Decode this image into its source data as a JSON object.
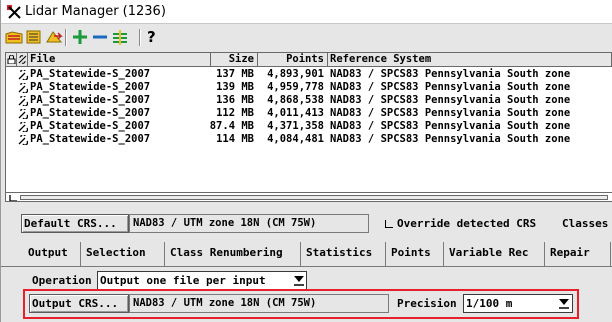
{
  "window": {
    "title": "Lidar Manager (1236)"
  },
  "toolbar": {
    "buttons": [
      "open-files-icon",
      "open-folder-icon",
      "import-icon",
      "add-icon",
      "remove-icon",
      "remove-all-icon",
      "help-icon"
    ],
    "help_label": "?"
  },
  "list": {
    "headers": {
      "file": "File",
      "size": "Size",
      "points": "Points",
      "crs": "Reference System"
    },
    "rows": [
      {
        "file": "PA_Statewide-S_2007",
        "size": "137 MB",
        "points": "4,893,901",
        "crs": "NAD83 / SPCS83 Pennsylvania South zone"
      },
      {
        "file": "PA_Statewide-S_2007",
        "size": "139 MB",
        "points": "4,959,778",
        "crs": "NAD83 / SPCS83 Pennsylvania South zone"
      },
      {
        "file": "PA_Statewide-S_2007",
        "size": "136 MB",
        "points": "4,868,538",
        "crs": "NAD83 / SPCS83 Pennsylvania South zone"
      },
      {
        "file": "PA_Statewide-S_2007",
        "size": "112 MB",
        "points": "4,011,413",
        "crs": "NAD83 / SPCS83 Pennsylvania South zone"
      },
      {
        "file": "PA_Statewide-S_2007",
        "size": "87.4 MB",
        "points": "4,371,358",
        "crs": "NAD83 / SPCS83 Pennsylvania South zone"
      },
      {
        "file": "PA_Statewide-S_2007",
        "size": "114 MB",
        "points": "4,084,481",
        "crs": "NAD83 / SPCS83 Pennsylvania South zone"
      }
    ]
  },
  "default_crs": {
    "button_label": "Default CRS...",
    "value": "NAD83 / UTM zone 18N (CM 75W)",
    "override_label": "Override detected CRS",
    "override_checked": false,
    "classes_label": "Classes"
  },
  "tabs": [
    {
      "label": "Output",
      "active": true
    },
    {
      "label": "Selection",
      "active": false
    },
    {
      "label": "Class Renumbering",
      "active": false
    },
    {
      "label": "Statistics",
      "active": false
    },
    {
      "label": "Points",
      "active": false
    },
    {
      "label": "Variable Rec",
      "active": false
    },
    {
      "label": "Repair",
      "active": false
    }
  ],
  "output": {
    "operation_label": "Operation",
    "operation_value": "Output one file per input",
    "output_crs_button": "Output CRS...",
    "output_crs_value": "NAD83 / UTM zone 18N (CM 75W)",
    "precision_label": "Precision",
    "precision_value": "1/100 m"
  },
  "colors": {
    "highlight": "#e8202a",
    "window_bg": "#e6e6e6"
  }
}
